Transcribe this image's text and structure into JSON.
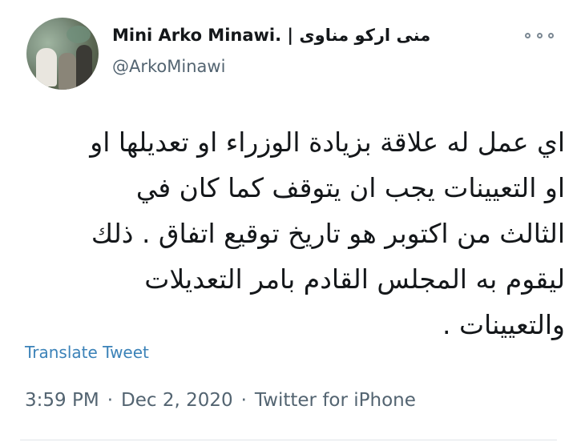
{
  "author": {
    "display_name": "Mini Arko Minawi. | منى اركو مناوى",
    "handle": "@ArkoMinawi"
  },
  "tweet": {
    "text": "اي عمل له علاقة بزيادة الوزراء او تعديلها او\nاو التعيينات يجب ان يتوقف كما كان في\nالثالث من اكتوبر هو تاريخ توقيع اتفاق . ذلك\nليقوم به المجلس القادم بامر التعديلات\nوالتعيينات .",
    "translate_label": "Translate Tweet"
  },
  "meta": {
    "time": "3:59 PM",
    "date": "Dec 2, 2020",
    "separator": "·",
    "source": "Twitter for iPhone"
  },
  "icons": {
    "more": "more-options-icon"
  },
  "colors": {
    "text": "#14171a",
    "secondary": "#536471",
    "link": "#3b82b8"
  }
}
